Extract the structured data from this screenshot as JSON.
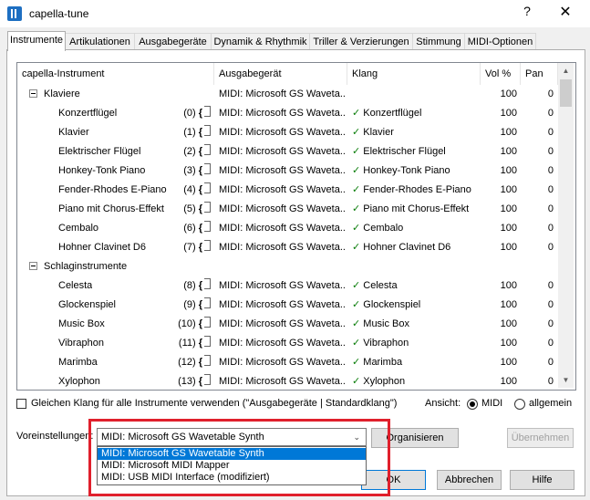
{
  "window": {
    "title": "capella-tune",
    "help_glyph": "?",
    "close_glyph": "✕"
  },
  "tabs": [
    "Instrumente",
    "Artikulationen",
    "Ausgabegeräte",
    "Dynamik & Rhythmik",
    "Triller & Verzierungen",
    "Stimmung",
    "MIDI-Optionen"
  ],
  "list": {
    "headers": [
      "capella-Instrument",
      "Ausgabegerät",
      "Klang",
      "Vol %",
      "Pan"
    ],
    "rows": [
      {
        "kind": "group",
        "name": "Klaviere",
        "device": "MIDI: Microsoft GS Waveta...",
        "sound": "",
        "vol": "100",
        "pan": "0"
      },
      {
        "kind": "item",
        "name": "Konzertflügel",
        "idx": "(0)",
        "device": "MIDI: Microsoft GS Waveta...",
        "sound": "✓ Konzertflügel",
        "vol": "100",
        "pan": "0"
      },
      {
        "kind": "item",
        "name": "Klavier",
        "idx": "(1)",
        "device": "MIDI: Microsoft GS Waveta...",
        "sound": "✓ Klavier",
        "vol": "100",
        "pan": "0"
      },
      {
        "kind": "item",
        "name": "Elektrischer Flügel",
        "idx": "(2)",
        "device": "MIDI: Microsoft GS Waveta...",
        "sound": "✓ Elektrischer Flügel",
        "vol": "100",
        "pan": "0"
      },
      {
        "kind": "item",
        "name": "Honkey-Tonk Piano",
        "idx": "(3)",
        "device": "MIDI: Microsoft GS Waveta...",
        "sound": "✓ Honkey-Tonk Piano",
        "vol": "100",
        "pan": "0"
      },
      {
        "kind": "item",
        "name": "Fender-Rhodes E-Piano",
        "idx": "(4)",
        "device": "MIDI: Microsoft GS Waveta...",
        "sound": "✓ Fender-Rhodes E-Piano",
        "vol": "100",
        "pan": "0"
      },
      {
        "kind": "item",
        "name": "Piano mit Chorus-Effekt",
        "idx": "(5)",
        "device": "MIDI: Microsoft GS Waveta...",
        "sound": "✓ Piano mit Chorus-Effekt",
        "vol": "100",
        "pan": "0"
      },
      {
        "kind": "item",
        "name": "Cembalo",
        "idx": "(6)",
        "device": "MIDI: Microsoft GS Waveta...",
        "sound": "✓ Cembalo",
        "vol": "100",
        "pan": "0"
      },
      {
        "kind": "item",
        "name": "Hohner Clavinet D6",
        "idx": "(7)",
        "device": "MIDI: Microsoft GS Waveta...",
        "sound": "✓ Hohner Clavinet D6",
        "vol": "100",
        "pan": "0"
      },
      {
        "kind": "group",
        "name": "Schlaginstrumente",
        "device": "",
        "sound": "",
        "vol": "",
        "pan": ""
      },
      {
        "kind": "item",
        "name": "Celesta",
        "idx": "(8)",
        "device": "MIDI: Microsoft GS Waveta...",
        "sound": "✓ Celesta",
        "vol": "100",
        "pan": "0"
      },
      {
        "kind": "item",
        "name": "Glockenspiel",
        "idx": "(9)",
        "device": "MIDI: Microsoft GS Waveta...",
        "sound": "✓ Glockenspiel",
        "vol": "100",
        "pan": "0"
      },
      {
        "kind": "item",
        "name": "Music Box",
        "idx": "(10)",
        "device": "MIDI: Microsoft GS Waveta...",
        "sound": "✓ Music Box",
        "vol": "100",
        "pan": "0"
      },
      {
        "kind": "item",
        "name": "Vibraphon",
        "idx": "(11)",
        "device": "MIDI: Microsoft GS Waveta...",
        "sound": "✓ Vibraphon",
        "vol": "100",
        "pan": "0"
      },
      {
        "kind": "item",
        "name": "Marimba",
        "idx": "(12)",
        "device": "MIDI: Microsoft GS Waveta...",
        "sound": "✓ Marimba",
        "vol": "100",
        "pan": "0"
      },
      {
        "kind": "item",
        "name": "Xylophon",
        "idx": "(13)",
        "device": "MIDI: Microsoft GS Waveta...",
        "sound": "✓ Xylophon",
        "vol": "100",
        "pan": "0"
      }
    ]
  },
  "options": {
    "same_sound_label": "Gleichen Klang für alle Instrumente verwenden (\"Ausgabegeräte | Standardklang\")",
    "view_label": "Ansicht:",
    "view_midi": "MIDI",
    "view_all": "allgemein"
  },
  "presets": {
    "label": "Voreinstellungen:",
    "selected": "MIDI: Microsoft GS Wavetable Synth",
    "options": [
      "MIDI: Microsoft GS Wavetable Synth",
      "MIDI: Microsoft MIDI Mapper",
      "MIDI: USB MIDI Interface (modifiziert)"
    ],
    "organize_label": "Organisieren",
    "apply_label": "Übernehmen"
  },
  "footer": {
    "ok_label": "OK",
    "cancel_label": "Abbrechen",
    "help_label": "Hilfe"
  },
  "colors": {
    "highlight": "#0078d7",
    "check": "#0a7d0a",
    "annotation_box": "#e0202c"
  }
}
